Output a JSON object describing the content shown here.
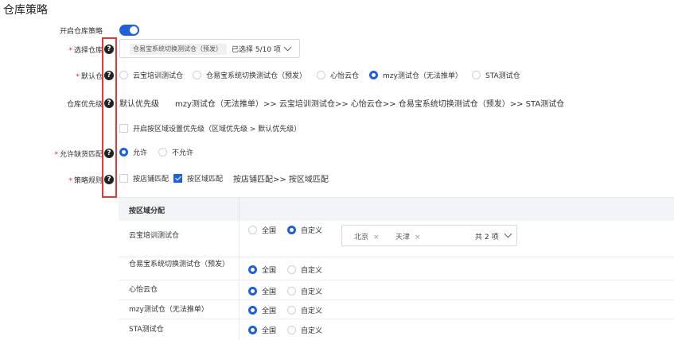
{
  "page": {
    "title": "仓库策略"
  },
  "colors": {
    "primary": "#1f5fd8",
    "required": "#f5222d",
    "highlight_border": "#e53935"
  },
  "form": {
    "enable_strategy": {
      "label": "开启仓库策略",
      "enabled": true
    },
    "warehouse_select": {
      "label": "选择仓库",
      "selected_tag": "仓易宝系统切换测试仓（预发）",
      "selected_count": "已选择 5/10 项"
    },
    "default_warehouse": {
      "label": "默认仓",
      "options": [
        "云宝培训测试仓",
        "仓易宝系统切换测试仓（预发）",
        "心怡云仓",
        "mzy测试仓（无法推单）",
        "STA测试仓"
      ],
      "selected": "mzy测试仓（无法推单）"
    },
    "priority": {
      "label": "仓库优先级",
      "heading": "默认优先级",
      "sequence": "mzy测试仓（无法推单）>> 云宝培训测试仓>> 心怡云仓>> 仓易宝系统切换测试仓（预发）>> STA测试仓",
      "region_checkbox": "开启按区域设置优先级（区域优先级 > 默认优先级）"
    },
    "allow_shortage": {
      "label": "允许缺货匹配",
      "options": [
        "允许",
        "不允许"
      ],
      "selected": "允许"
    },
    "strategy_rule": {
      "label": "策略规则",
      "options": [
        "按店铺匹配",
        "按区域匹配"
      ],
      "checked": "按区域匹配",
      "sequence": "按店铺匹配>> 按区域匹配"
    }
  },
  "region_table": {
    "header": "按区域分配",
    "scope_options": [
      "全国",
      "自定义"
    ],
    "rows": [
      {
        "warehouse": "云宝培训测试仓",
        "scope": "自定义"
      },
      {
        "warehouse": "仓易宝系统切换测试仓（预发）",
        "scope": "全国"
      },
      {
        "warehouse": "心怡云仓",
        "scope": "全国"
      },
      {
        "warehouse": "mzy测试仓（无法推单）",
        "scope": "全国"
      },
      {
        "warehouse": "STA测试仓",
        "scope": "全国"
      }
    ],
    "region_select": {
      "tags": [
        "北京",
        "天津"
      ],
      "count": "共 2 项"
    }
  }
}
